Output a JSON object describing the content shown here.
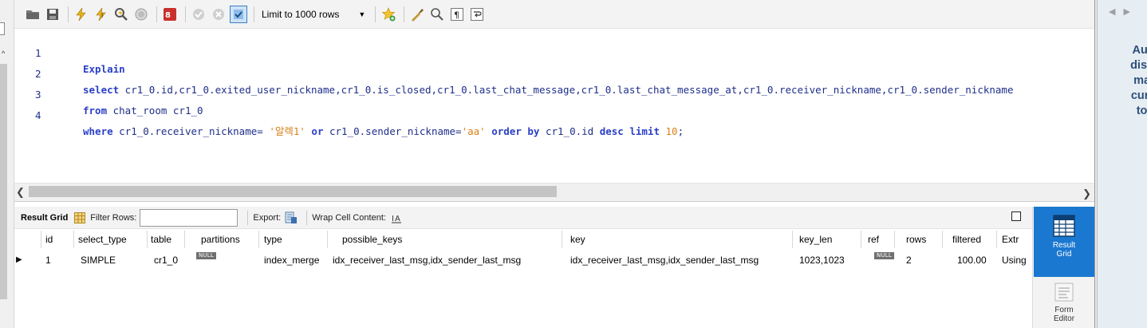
{
  "toolbar": {
    "limit_label": "Limit to 1000 rows"
  },
  "editor": {
    "lines": [
      {
        "n": "1",
        "parts": [
          {
            "t": "Explain",
            "c": "kw"
          }
        ]
      },
      {
        "n": "2",
        "parts": [
          {
            "t": "select",
            "c": "kw"
          },
          {
            "t": " cr1_0.id,cr1_0.exited_user_nickname,cr1_0.is_closed,cr1_0.last_chat_message,cr1_0.last_chat_message_at,cr1_0.receiver_nickname,cr1_0.sender_nickname",
            "c": "plain"
          }
        ]
      },
      {
        "n": "3",
        "parts": [
          {
            "t": "from",
            "c": "kw"
          },
          {
            "t": " chat_room cr1_0",
            "c": "plain"
          }
        ]
      },
      {
        "n": "4",
        "parts": [
          {
            "t": "where",
            "c": "kw"
          },
          {
            "t": " cr1_0.receiver_nickname= ",
            "c": "plain"
          },
          {
            "t": "'알렉1'",
            "c": "str"
          },
          {
            "t": " ",
            "c": "plain"
          },
          {
            "t": "or",
            "c": "kw"
          },
          {
            "t": " cr1_0.sender_nickname=",
            "c": "plain"
          },
          {
            "t": "'aa'",
            "c": "str"
          },
          {
            "t": " ",
            "c": "plain"
          },
          {
            "t": "order by",
            "c": "kw"
          },
          {
            "t": " cr1_0.id ",
            "c": "plain"
          },
          {
            "t": "desc",
            "c": "kw"
          },
          {
            "t": " ",
            "c": "plain"
          },
          {
            "t": "limit",
            "c": "kw"
          },
          {
            "t": " ",
            "c": "plain"
          },
          {
            "t": "10",
            "c": "num"
          },
          {
            "t": ";",
            "c": "plain"
          }
        ]
      }
    ]
  },
  "result_toolbar": {
    "result_grid_label": "Result Grid",
    "filter_rows_label": "Filter Rows:",
    "filter_value": "",
    "export_label": "Export:",
    "wrap_label": "Wrap Cell Content:"
  },
  "grid": {
    "columns": [
      "id",
      "select_type",
      "table",
      "partitions",
      "type",
      "possible_keys",
      "key",
      "key_len",
      "ref",
      "rows",
      "filtered",
      "Extr"
    ],
    "rows": [
      [
        "1",
        "SIMPLE",
        "cr1_0",
        "NULL",
        "index_merge",
        "idx_receiver_last_msg,idx_sender_last_msg",
        "idx_receiver_last_msg,idx_sender_last_msg",
        "1023,1023",
        "NULL",
        "2",
        "100.00",
        "Using"
      ]
    ]
  },
  "side_tabs": {
    "result_grid": [
      "Result",
      "Grid"
    ],
    "form_editor": [
      "Form",
      "Editor"
    ]
  },
  "right_panel": {
    "lines": [
      "Auto",
      "disab",
      "man",
      "curre",
      "tog"
    ]
  },
  "colors": {
    "keyword": "#2a3fc7",
    "string": "#d7811a",
    "active_tab": "#1b78d0"
  }
}
